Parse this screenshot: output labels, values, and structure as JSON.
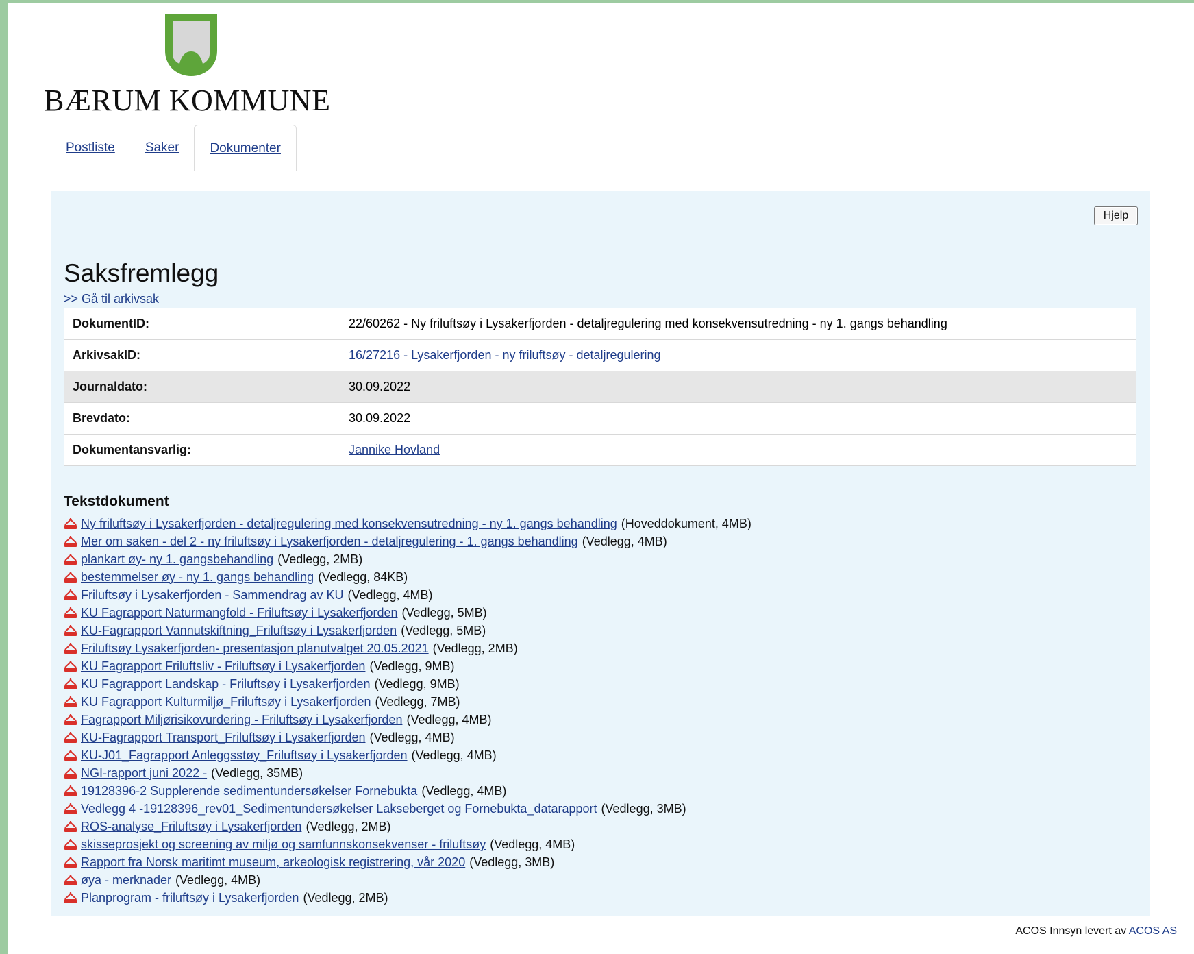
{
  "municipality": {
    "name": "BÆRUM KOMMUNE",
    "shield_color": "#5ea53a"
  },
  "tabs": [
    {
      "label": "Postliste"
    },
    {
      "label": "Saker"
    },
    {
      "label": "Dokumenter",
      "active": true
    }
  ],
  "panel": {
    "help_label": "Hjelp",
    "title": "Saksfremlegg",
    "archive_link": ">> Gå til arkivsak"
  },
  "meta": {
    "rows": [
      {
        "label": "DokumentID:",
        "value": "22/60262 - Ny friluftsøy i Lysakerfjorden - detaljregulering med konsekvensutredning - ny 1. gangs behandling",
        "link": false
      },
      {
        "label": "ArkivsakID:",
        "value": "16/27216 - Lysakerfjorden - ny friluftsøy - detaljregulering",
        "link": true
      },
      {
        "label": "Journaldato:",
        "value": "30.09.2022",
        "link": false
      },
      {
        "label": "Brevdato:",
        "value": "30.09.2022",
        "link": false
      },
      {
        "label": "Dokumentansvarlig:",
        "value": "Jannike Hovland",
        "link": true
      }
    ]
  },
  "documents": {
    "heading": "Tekstdokument",
    "items": [
      {
        "title": "Ny friluftsøy i Lysakerfjorden - detaljregulering med konsekvensutredning - ny 1. gangs behandling",
        "meta": "(Hoveddokument, 4MB)"
      },
      {
        "title": "Mer om saken - del 2 - ny friluftsøy i Lysakerfjorden - detaljregulering - 1. gangs behandling",
        "meta": "(Vedlegg, 4MB)"
      },
      {
        "title": "plankart øy- ny 1. gangsbehandling",
        "meta": "(Vedlegg, 2MB)"
      },
      {
        "title": "bestemmelser øy - ny 1. gangs behandling",
        "meta": "(Vedlegg, 84KB)"
      },
      {
        "title": "Friluftsøy i Lysakerfjorden - Sammendrag av KU",
        "meta": "(Vedlegg, 4MB)"
      },
      {
        "title": "KU Fagrapport Naturmangfold - Friluftsøy i Lysakerfjorden",
        "meta": "(Vedlegg, 5MB)"
      },
      {
        "title": "KU-Fagrapport Vannutskiftning_Friluftsøy i Lysakerfjorden",
        "meta": "(Vedlegg, 5MB)"
      },
      {
        "title": "Friluftsøy Lysakerfjorden- presentasjon planutvalget 20.05.2021",
        "meta": "(Vedlegg, 2MB)"
      },
      {
        "title": "KU Fagrapport Friluftsliv - Friluftsøy i Lysakerfjorden",
        "meta": "(Vedlegg, 9MB)"
      },
      {
        "title": "KU Fagrapport Landskap - Friluftsøy i Lysakerfjorden",
        "meta": "(Vedlegg, 9MB)"
      },
      {
        "title": "KU Fagrapport Kulturmiljø_Friluftsøy i Lysakerfjorden",
        "meta": "(Vedlegg, 7MB)"
      },
      {
        "title": "Fagrapport Miljørisikovurdering - Friluftsøy i Lysakerfjorden",
        "meta": "(Vedlegg, 4MB)"
      },
      {
        "title": "KU-Fagrapport Transport_Friluftsøy i Lysakerfjorden",
        "meta": "(Vedlegg, 4MB)"
      },
      {
        "title": "KU-J01_Fagrapport Anleggsstøy_Friluftsøy i Lysakerfjorden",
        "meta": "(Vedlegg, 4MB)"
      },
      {
        "title": "NGI-rapport juni 2022 -",
        "meta": "(Vedlegg, 35MB)"
      },
      {
        "title": "19128396-2 Supplerende sedimentundersøkelser Fornebukta",
        "meta": "(Vedlegg, 4MB)"
      },
      {
        "title": "Vedlegg 4 -19128396_rev01_Sedimentundersøkelser Lakseberget og Fornebukta_datarapport",
        "meta": "(Vedlegg, 3MB)"
      },
      {
        "title": "ROS-analyse_Friluftsøy i Lysakerfjorden",
        "meta": "(Vedlegg, 2MB)"
      },
      {
        "title": "skisseprosjekt og screening av miljø og samfunnskonsekvenser - friluftsøy",
        "meta": "(Vedlegg, 4MB)"
      },
      {
        "title": "Rapport fra Norsk maritimt museum, arkeologisk registrering, vår 2020",
        "meta": "(Vedlegg, 3MB)"
      },
      {
        "title": "øya - merknader",
        "meta": "(Vedlegg, 4MB)"
      },
      {
        "title": "Planprogram - friluftsøy i Lysakerfjorden",
        "meta": "(Vedlegg, 2MB)"
      }
    ]
  },
  "footer": {
    "text": "ACOS Innsyn levert av",
    "link": "ACOS AS"
  },
  "colors": {
    "link": "#1f3d8a",
    "panel_bg": "#eaf5fb",
    "pdf_red": "#d9302a"
  },
  "icons": {
    "document": "pdf-icon"
  }
}
